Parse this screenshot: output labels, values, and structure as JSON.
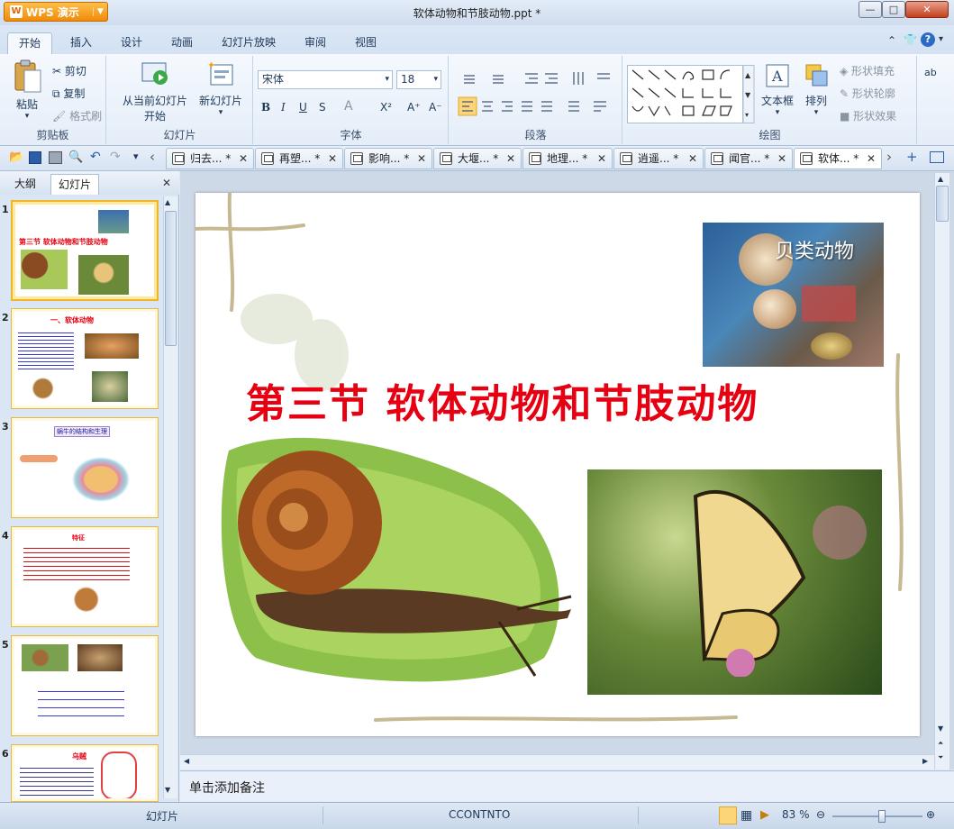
{
  "app": {
    "name": "WPS 演示",
    "document_title": "软体动物和节肢动物.ppt *"
  },
  "window_buttons": {
    "minimize": "—",
    "maximize": "□",
    "close": "✕"
  },
  "menu_tabs": [
    "开始",
    "插入",
    "设计",
    "动画",
    "幻灯片放映",
    "审阅",
    "视图"
  ],
  "active_tab": "开始",
  "ribbon": {
    "clipboard": {
      "paste": "粘贴",
      "cut": "剪切",
      "copy": "复制",
      "format_painter": "格式刷",
      "label": "剪贴板"
    },
    "slides": {
      "from_current_line1": "从当前幻灯片",
      "from_current_line2": "开始",
      "new_slide": "新幻灯片",
      "label": "幻灯片"
    },
    "font": {
      "font_name": "宋体",
      "font_size": "18",
      "bold": "B",
      "italic": "I",
      "underline": "U",
      "shadow": "S",
      "color": "A",
      "superscript": "X²",
      "grow": "A⁺",
      "shrink": "A⁻",
      "label": "字体"
    },
    "paragraph": {
      "label": "段落"
    },
    "drawing": {
      "textbox": "文本框",
      "arrange": "排列",
      "shape_fill": "形状填充",
      "shape_outline": "形状轮廓",
      "shape_effect": "形状效果",
      "label": "绘图"
    },
    "right_cut": "ab"
  },
  "doc_tabs": [
    {
      "label": "归去... *"
    },
    {
      "label": "再塑... *"
    },
    {
      "label": "影响... *"
    },
    {
      "label": "大堰... *"
    },
    {
      "label": "地理... *"
    },
    {
      "label": "逍遥... *"
    },
    {
      "label": "闻官... *"
    },
    {
      "label": "软体... *"
    }
  ],
  "left_pane": {
    "tabs": [
      "大纲",
      "幻灯片"
    ],
    "close": "✕",
    "thumbnails": [
      {
        "num": "1",
        "title": "第三节 软体动物和节肢动物"
      },
      {
        "num": "2",
        "title": "一、软体动物"
      },
      {
        "num": "3",
        "title": "蜗牛的结构和生理"
      },
      {
        "num": "4",
        "title": "特征"
      },
      {
        "num": "5",
        "title": ""
      },
      {
        "num": "6",
        "title": "乌贼"
      }
    ]
  },
  "slide": {
    "title": "第三节  软体动物和节肢动物",
    "shell_picture_label": "贝类动物"
  },
  "notes_placeholder": "单击添加备注",
  "status": {
    "left": "幻灯片",
    "center": "CCONTNTO",
    "zoom": "83 %",
    "zoom_level": 0.55
  },
  "colors": {
    "title_red": "#e60012",
    "accent_orange": "#f08a0a",
    "ribbon_bg": "#e4edf8"
  }
}
